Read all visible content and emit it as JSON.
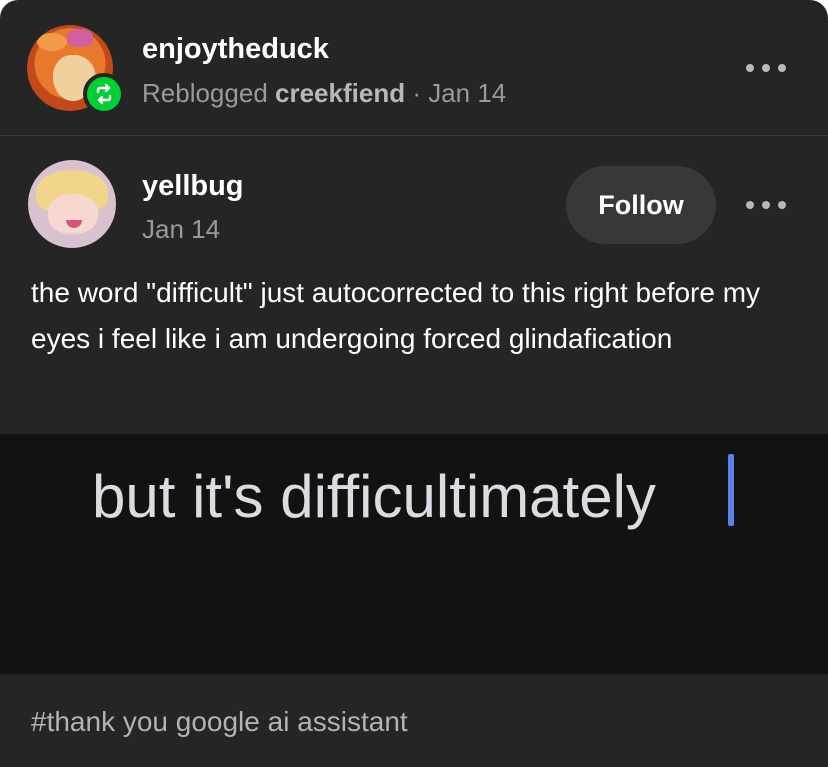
{
  "reblog": {
    "username": "enjoytheduck",
    "reblogged_prefix": "Reblogged",
    "source": "creekfiend",
    "separator": " · ",
    "date": "Jan 14"
  },
  "post": {
    "username": "yellbug",
    "date": "Jan 14",
    "follow_label": "Follow",
    "body": "the word \"difficult\" just autocorrected to this right before my eyes i feel like i am undergoing forced glindafication",
    "image_text": "but it's difficultimately",
    "tags": "#thank you google ai assistant"
  },
  "colors": {
    "background": "#252525",
    "reblog_badge": "#00cf35",
    "cursor": "#5b80e8"
  },
  "icons": {
    "reblog_badge": "reblog-icon",
    "more": "more-options-icon"
  }
}
